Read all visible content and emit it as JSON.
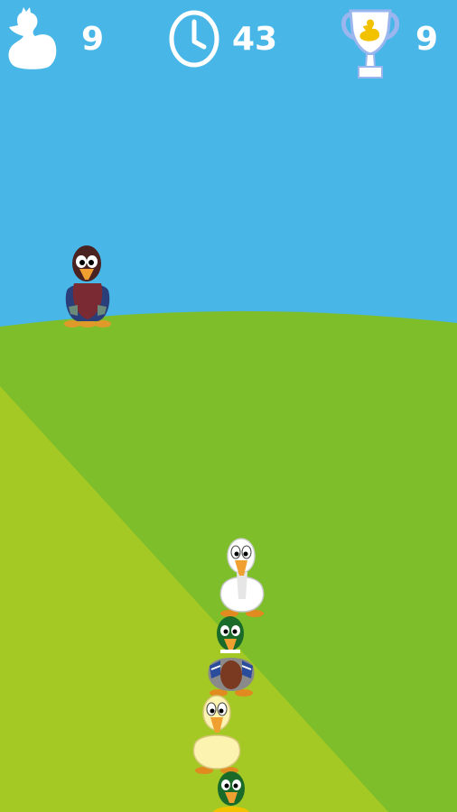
{
  "hud": {
    "ducks_left": "9",
    "time_left": "43",
    "best_score": "9"
  },
  "colors": {
    "sky": "#48b7e8",
    "hill_dark": "#7dbe2a",
    "hill_light": "#a4c925",
    "hud_white": "#ffffff",
    "trophy_blue": "#9bb6ef"
  },
  "icons": {
    "ducks_left": "duck-silhouette-icon",
    "time_left": "clock-icon",
    "best_score": "trophy-icon"
  },
  "ducks": [
    {
      "kind": "brown-duck"
    },
    {
      "kind": "white-duck"
    },
    {
      "kind": "mallard-duck"
    },
    {
      "kind": "yellow-duck"
    },
    {
      "kind": "mallard-duck-partial"
    }
  ]
}
